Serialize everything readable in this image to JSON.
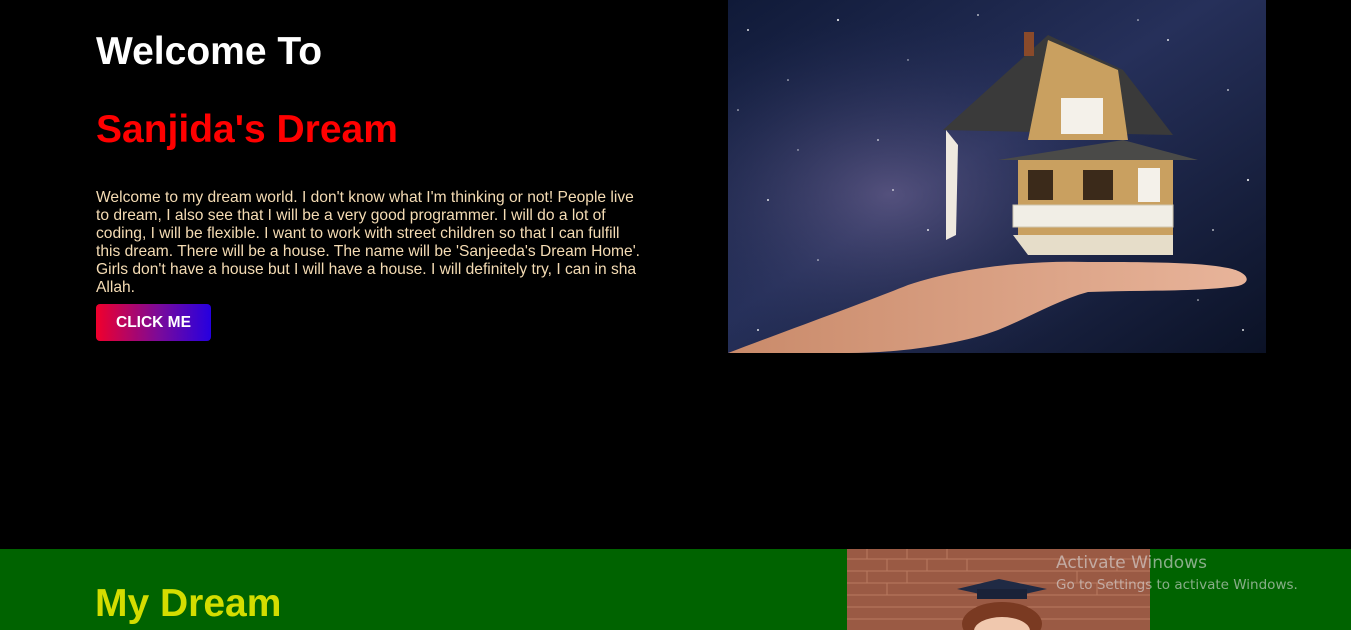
{
  "hero": {
    "welcome": "Welcome To",
    "title": "Sanjida's Dream",
    "intro": "Welcome to my dream world. I don't know what I'm thinking or not! People live to dream, I also see that I will be a very good programmer. I will do a lot of coding, I will be flexible. I want to work with street children so that I can fulfill this dream. There will be a house. The name will be 'Sanjeeda's Dream Home'. Girls don't have a house but I will have a house. I will definitely try, I can in sha Allah.",
    "button_label": "CLICK ME"
  },
  "dream_section": {
    "title": "My Dream"
  },
  "os_watermark": {
    "line1": "Activate Windows",
    "line2": "Go to Settings to activate Windows."
  },
  "colors": {
    "page_bg": "#000000",
    "title_red": "#ff0000",
    "section_green": "#006300",
    "section_title": "#d4dd00",
    "intro_text": "#f5dcb4"
  }
}
